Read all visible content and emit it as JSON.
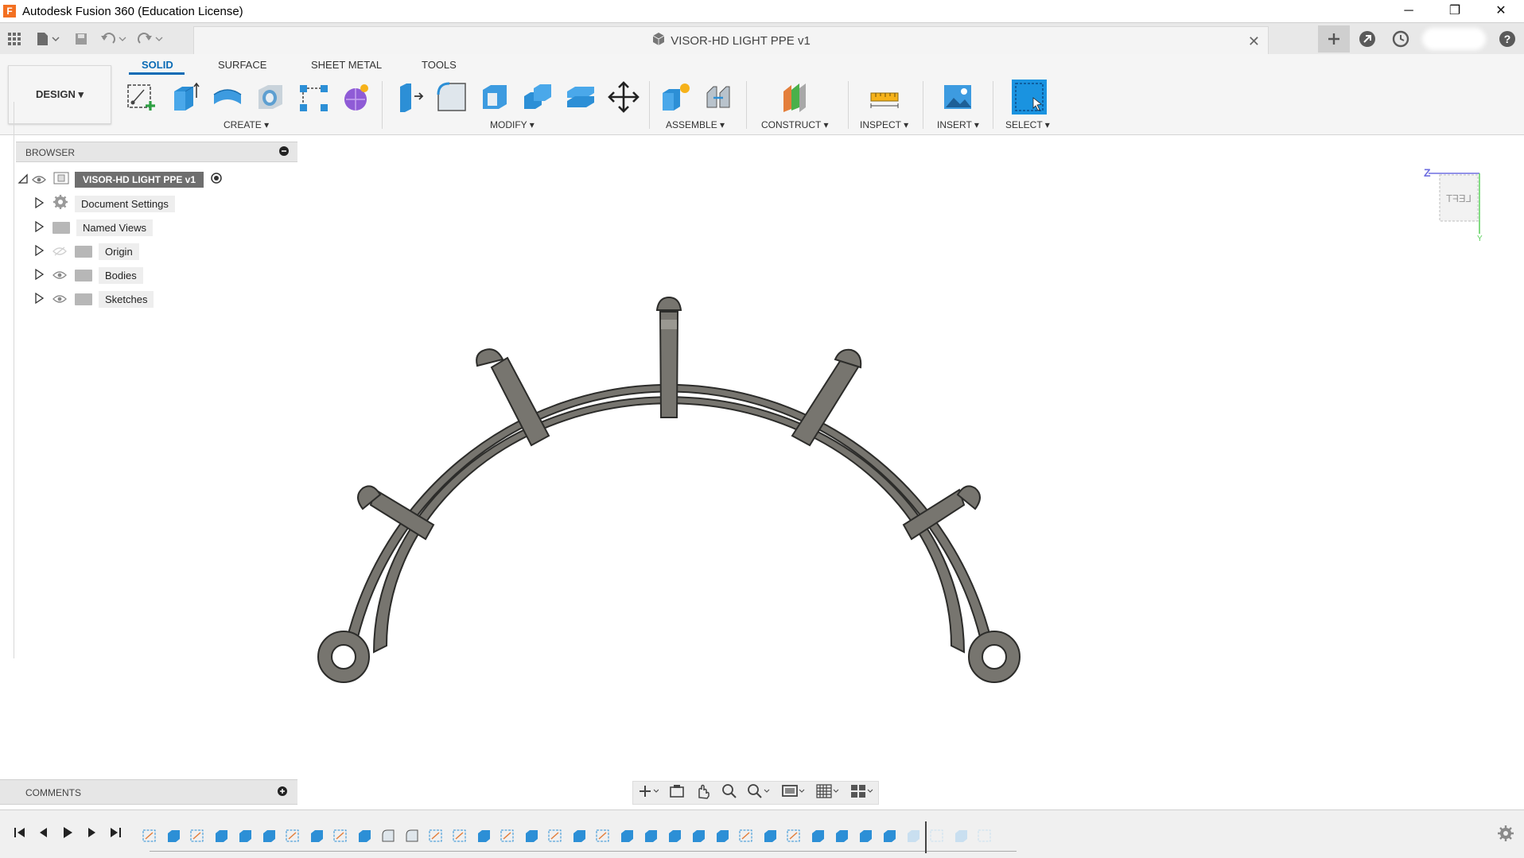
{
  "window": {
    "title": "Autodesk Fusion 360 (Education License)",
    "app_icon": "F",
    "minimize": "─",
    "restore": "❐",
    "close": "✕"
  },
  "qat": {
    "apps_icon": "grid-icon",
    "document_tab": "VISOR-HD LIGHT PPE v1",
    "tab_close": "✕"
  },
  "ribbon": {
    "workspace": "DESIGN ▾",
    "tabs": [
      "SOLID",
      "SURFACE",
      "SHEET METAL",
      "TOOLS"
    ],
    "groups": {
      "create": "CREATE ▾",
      "modify": "MODIFY ▾",
      "assemble": "ASSEMBLE ▾",
      "construct": "CONSTRUCT ▾",
      "inspect": "INSPECT ▾",
      "insert": "INSERT ▾",
      "select": "SELECT ▾"
    }
  },
  "browser": {
    "title": "BROWSER",
    "root": "VISOR-HD LIGHT PPE v1",
    "items": [
      {
        "label": "Document Settings"
      },
      {
        "label": "Named Views"
      },
      {
        "label": "Origin"
      },
      {
        "label": "Bodies"
      },
      {
        "label": "Sketches"
      }
    ]
  },
  "comments": {
    "title": "COMMENTS"
  },
  "viewcube": {
    "face": "LEFT",
    "axis_z": "Z",
    "axis_y": "Y"
  },
  "colors": {
    "accent": "#0a6bb5",
    "model_fill": "#77756f",
    "model_stroke": "#2c2c2a",
    "select_blue": "#1a93e0"
  }
}
